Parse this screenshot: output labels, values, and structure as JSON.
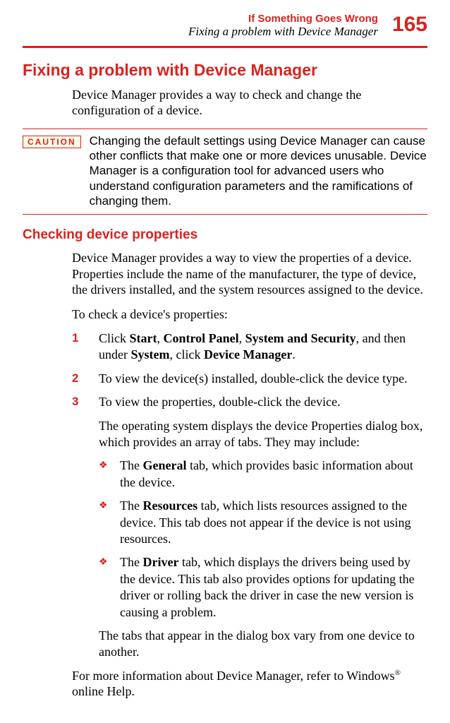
{
  "header": {
    "chapter": "If Something Goes Wrong",
    "subtitle": "Fixing a problem with Device Manager",
    "page_number": "165"
  },
  "section": {
    "heading": "Fixing a problem with Device Manager",
    "intro": "Device Manager provides a way to check and change the configuration of a device."
  },
  "caution": {
    "label": "CAUTION",
    "text": "Changing the default settings using Device Manager can cause other conflicts that make one or more devices unusable. Device Manager is a configuration tool for advanced users who understand configuration parameters and the ramifications of changing them."
  },
  "subsection": {
    "heading": "Checking device properties",
    "p1": "Device Manager provides a way to view the properties of a device. Properties include the name of the manufacturer, the type of device, the drivers installed, and the system resources assigned to the device.",
    "p2": "To check a device's properties:"
  },
  "steps": {
    "s1": {
      "num": "1",
      "runs": [
        {
          "t": "Click ",
          "b": false
        },
        {
          "t": "Start",
          "b": true
        },
        {
          "t": ", ",
          "b": false
        },
        {
          "t": "Control Panel",
          "b": true
        },
        {
          "t": ", ",
          "b": false
        },
        {
          "t": "System and Security",
          "b": true
        },
        {
          "t": ", and then under ",
          "b": false
        },
        {
          "t": "System",
          "b": true
        },
        {
          "t": ", click ",
          "b": false
        },
        {
          "t": "Device Manager",
          "b": true
        },
        {
          "t": ".",
          "b": false
        }
      ]
    },
    "s2": {
      "num": "2",
      "text": "To view the device(s) installed, double-click the device type."
    },
    "s3": {
      "num": "3",
      "text": "To view the properties, double-click the device."
    },
    "followup": "The operating system displays the device Properties dialog box, which provides an array of tabs. They may include:"
  },
  "bullets": {
    "b1": {
      "runs": [
        {
          "t": "The ",
          "b": false
        },
        {
          "t": "General",
          "b": true
        },
        {
          "t": " tab, which provides basic information about the device.",
          "b": false
        }
      ]
    },
    "b2": {
      "runs": [
        {
          "t": "The ",
          "b": false
        },
        {
          "t": "Resources",
          "b": true
        },
        {
          "t": " tab, which lists resources assigned to the device. This tab does not appear if the device is not using resources.",
          "b": false
        }
      ]
    },
    "b3": {
      "runs": [
        {
          "t": "The ",
          "b": false
        },
        {
          "t": "Driver",
          "b": true
        },
        {
          "t": " tab, which displays the drivers being used by the device. This tab also provides options for updating the driver or rolling back the driver in case the new version is causing a problem.",
          "b": false
        }
      ]
    }
  },
  "trailing": {
    "p1": "The tabs that appear in the dialog box vary from one device to another.",
    "p2_runs": [
      {
        "t": "For more information about Device Manager, refer to Windows",
        "b": false,
        "sup": false
      },
      {
        "t": "®",
        "b": false,
        "sup": true
      },
      {
        "t": " online Help.",
        "b": false,
        "sup": false
      }
    ]
  }
}
